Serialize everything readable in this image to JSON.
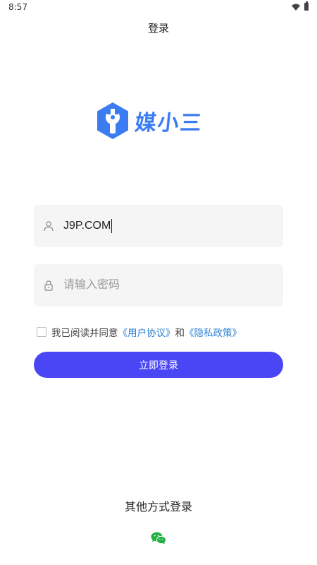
{
  "status_bar": {
    "time": "8:57"
  },
  "header": {
    "title": "登录"
  },
  "logo": {
    "brand_text": "媒小三",
    "icon": "wrench-hexagon-icon",
    "brand_color": "#3b7cf3"
  },
  "form": {
    "username": {
      "value": "J9P.COM",
      "icon": "user-icon"
    },
    "password": {
      "placeholder": "请输入密码",
      "icon": "lock-icon"
    }
  },
  "agreement": {
    "checked": false,
    "prefix": "我已阅读并同意",
    "user_agreement": "《用户协议》",
    "conjunction": "和",
    "privacy_policy": "《隐私政策》",
    "link_color": "#2a7fd4"
  },
  "login_button": {
    "label": "立即登录",
    "color": "#4a46f5"
  },
  "other_login": {
    "title": "其他方式登录",
    "wechat_icon": "wechat-icon",
    "wechat_color": "#22b043"
  }
}
